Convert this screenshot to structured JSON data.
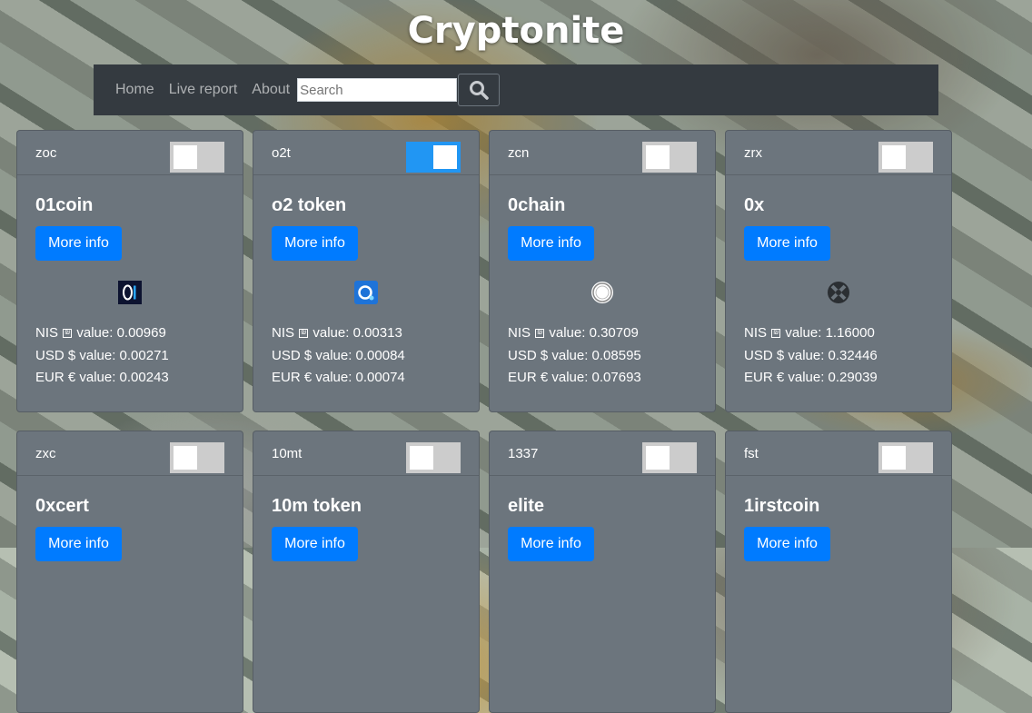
{
  "site": {
    "title": "Cryptonite"
  },
  "nav": {
    "links": [
      "Home",
      "Live report",
      "About"
    ],
    "search": {
      "placeholder": "Search",
      "value": ""
    },
    "search_button_icon": "search-icon"
  },
  "labels": {
    "more_info": "More info",
    "nis_prefix": "NIS",
    "nis_suffix": " value: ",
    "usd_prefix": "USD $ value: ",
    "eur_prefix": "EUR € value: "
  },
  "colors": {
    "navbar": "#343a40",
    "card": "#6c757d",
    "primary_button": "#007bff",
    "toggle_on": "#2196f3",
    "toggle_off": "#cccccc"
  },
  "cards": [
    {
      "symbol": "zoc",
      "name": "01coin",
      "toggle_on": false,
      "icon": "01coin-logo-icon",
      "nis": "0.00969",
      "usd": "0.00271",
      "eur": "0.00243"
    },
    {
      "symbol": "o2t",
      "name": "o2 token",
      "toggle_on": true,
      "icon": "o2-token-logo-icon",
      "nis": "0.00313",
      "usd": "0.00084",
      "eur": "0.00074"
    },
    {
      "symbol": "zcn",
      "name": "0chain",
      "toggle_on": false,
      "icon": "0chain-logo-icon",
      "nis": "0.30709",
      "usd": "0.08595",
      "eur": "0.07693"
    },
    {
      "symbol": "zrx",
      "name": "0x",
      "toggle_on": false,
      "icon": "0x-logo-icon",
      "nis": "1.16000",
      "usd": "0.32446",
      "eur": "0.29039"
    },
    {
      "symbol": "zxc",
      "name": "0xcert",
      "toggle_on": false
    },
    {
      "symbol": "10mt",
      "name": "10m token",
      "toggle_on": false
    },
    {
      "symbol": "1337",
      "name": "elite",
      "toggle_on": false
    },
    {
      "symbol": "fst",
      "name": "1irstcoin",
      "toggle_on": false
    }
  ]
}
